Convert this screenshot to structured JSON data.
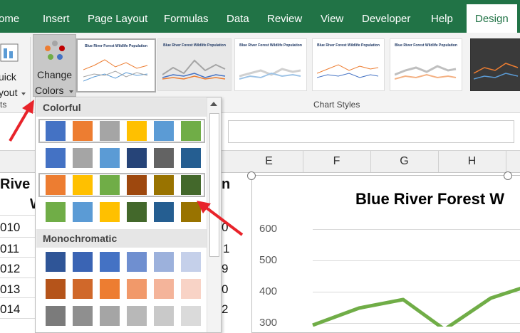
{
  "tabs": [
    "ome",
    "Insert",
    "Page Layout",
    "Formulas",
    "Data",
    "Review",
    "View",
    "Developer",
    "Help",
    "Design"
  ],
  "active_tab": "Design",
  "ribbon": {
    "quick_layout_line1": "uick",
    "quick_layout_line2": "yout",
    "change_colors_line1": "Change",
    "change_colors_line2": "Colors",
    "group_left_label": "ts",
    "chart_styles_label": "Chart Styles",
    "thumb_title": "Blue River Forest Wildlife Population"
  },
  "sheet": {
    "columns": [
      "E",
      "F",
      "G",
      "H"
    ],
    "left_texts": [
      "Rive",
      "W",
      "010",
      "011",
      "012",
      "013",
      "014"
    ],
    "right_texts": [
      "n",
      "0",
      "1",
      "9",
      "0",
      "2"
    ]
  },
  "chart": {
    "title": "Blue River Forest W",
    "y_ticks": [
      "600",
      "500",
      "400",
      "300"
    ],
    "line_color": "#70ad47"
  },
  "dropdown": {
    "colorful_label": "Colorful",
    "monochromatic_label": "Monochromatic",
    "colorful_rows": [
      [
        "#4472c4",
        "#ed7d31",
        "#a5a5a5",
        "#ffc000",
        "#5b9bd5",
        "#70ad47"
      ],
      [
        "#4472c4",
        "#a5a5a5",
        "#5b9bd5",
        "#264478",
        "#636363",
        "#255e91"
      ],
      [
        "#ed7d31",
        "#ffc000",
        "#70ad47",
        "#9e480e",
        "#997300",
        "#43682b"
      ],
      [
        "#70ad47",
        "#5b9bd5",
        "#ffc000",
        "#43682b",
        "#255e91",
        "#997300"
      ]
    ],
    "mono_rows": [
      [
        "#2f5597",
        "#3a64b4",
        "#4472c4",
        "#6f8fd0",
        "#9cb1dc",
        "#c5d0ea"
      ],
      [
        "#b5541a",
        "#d0682a",
        "#ed7d31",
        "#f1996a",
        "#f4b49a",
        "#f8d3c6"
      ],
      [
        "#7b7b7b",
        "#8f8f8f",
        "#a5a5a5",
        "#b8b8b8",
        "#c9c9c9",
        "#dadada"
      ]
    ]
  },
  "colors": {
    "brand_green": "#217346",
    "annotation_red": "#e8232a"
  }
}
